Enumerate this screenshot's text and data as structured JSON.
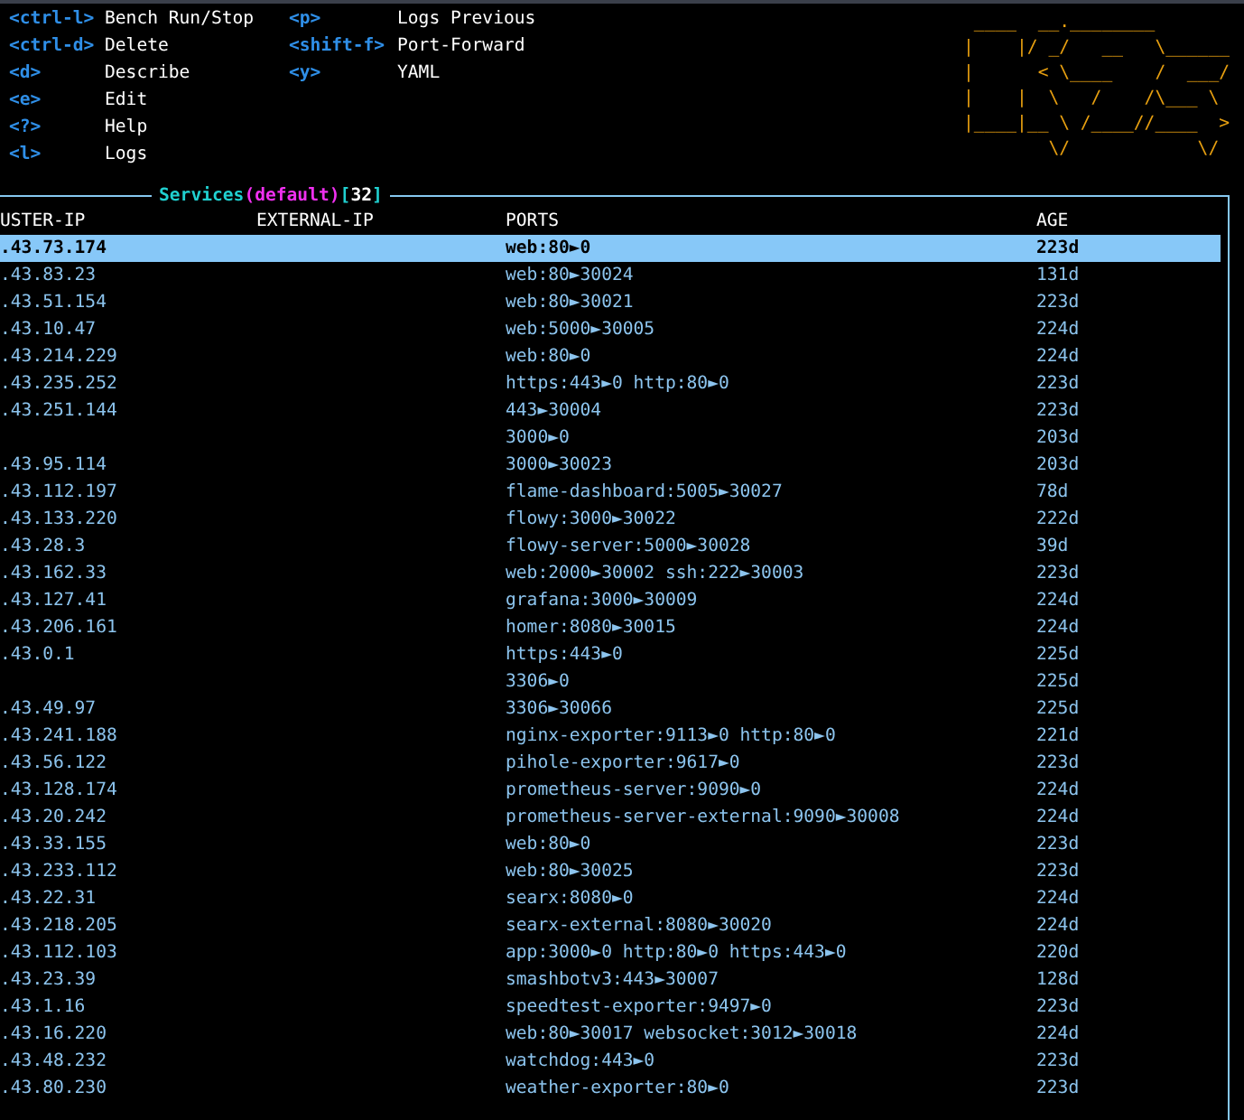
{
  "hints": [
    {
      "key": "<ctrl-l>",
      "action": "Bench Run/Stop"
    },
    {
      "key": "<ctrl-d>",
      "action": "Delete"
    },
    {
      "key": "<d>",
      "action": "Describe"
    },
    {
      "key": "<e>",
      "action": "Edit"
    },
    {
      "key": "<?>",
      "action": "Help"
    },
    {
      "key": "<l>",
      "action": "Logs"
    },
    {
      "key": "<p>",
      "action": "Logs Previous"
    },
    {
      "key": "<shift-f>",
      "action": "Port-Forward"
    },
    {
      "key": "<y>",
      "action": "YAML"
    }
  ],
  "logo": {
    "lines": [
      " ____  __.________       ",
      "|    |/ _/   __   \\______",
      "|      < \\____    /  ___/",
      "|    |  \\   /    /\\___ \\ ",
      "|____|__ \\ /____//____  >",
      "        \\/            \\/ "
    ]
  },
  "table": {
    "title": [
      {
        "kind": "resource",
        "text": "Services"
      },
      {
        "kind": "namespace",
        "text": "(default)"
      },
      {
        "kind": "bracket",
        "text": "["
      },
      {
        "kind": "count",
        "text": "32"
      },
      {
        "kind": "bracket",
        "text": "]"
      }
    ],
    "columns": [
      "USTER-IP",
      "EXTERNAL-IP",
      "PORTS",
      "AGE"
    ],
    "rows": [
      {
        "cluster_ip": ".43.73.174",
        "ports": "web:80►0",
        "age": "223d",
        "selected": true
      },
      {
        "cluster_ip": ".43.83.23",
        "ports": "web:80►30024",
        "age": "131d",
        "selected": false
      },
      {
        "cluster_ip": ".43.51.154",
        "ports": "web:80►30021",
        "age": "223d",
        "selected": false
      },
      {
        "cluster_ip": ".43.10.47",
        "ports": "web:5000►30005",
        "age": "224d",
        "selected": false
      },
      {
        "cluster_ip": ".43.214.229",
        "ports": "web:80►0",
        "age": "224d",
        "selected": false
      },
      {
        "cluster_ip": ".43.235.252",
        "ports": "https:443►0 http:80►0",
        "age": "223d",
        "selected": false
      },
      {
        "cluster_ip": ".43.251.144",
        "ports": "443►30004",
        "age": "223d",
        "selected": false
      },
      {
        "ports": "3000►0",
        "age": "203d",
        "selected": false
      },
      {
        "cluster_ip": ".43.95.114",
        "ports": "3000►30023",
        "age": "203d",
        "selected": false
      },
      {
        "cluster_ip": ".43.112.197",
        "ports": "flame-dashboard:5005►30027",
        "age": "78d",
        "selected": false
      },
      {
        "cluster_ip": ".43.133.220",
        "ports": "flowy:3000►30022",
        "age": "222d",
        "selected": false
      },
      {
        "cluster_ip": ".43.28.3",
        "ports": "flowy-server:5000►30028",
        "age": "39d",
        "selected": false
      },
      {
        "cluster_ip": ".43.162.33",
        "ports": "web:2000►30002 ssh:222►30003",
        "age": "223d",
        "selected": false
      },
      {
        "cluster_ip": ".43.127.41",
        "ports": "grafana:3000►30009",
        "age": "224d",
        "selected": false
      },
      {
        "cluster_ip": ".43.206.161",
        "ports": "homer:8080►30015",
        "age": "224d",
        "selected": false
      },
      {
        "cluster_ip": ".43.0.1",
        "ports": "https:443►0",
        "age": "225d",
        "selected": false
      },
      {
        "ports": "3306►0",
        "age": "225d",
        "selected": false
      },
      {
        "cluster_ip": ".43.49.97",
        "ports": "3306►30066",
        "age": "225d",
        "selected": false
      },
      {
        "cluster_ip": ".43.241.188",
        "ports": "nginx-exporter:9113►0 http:80►0",
        "age": "221d",
        "selected": false
      },
      {
        "cluster_ip": ".43.56.122",
        "ports": "pihole-exporter:9617►0",
        "age": "223d",
        "selected": false
      },
      {
        "cluster_ip": ".43.128.174",
        "ports": "prometheus-server:9090►0",
        "age": "224d",
        "selected": false
      },
      {
        "cluster_ip": ".43.20.242",
        "ports": "prometheus-server-external:9090►30008",
        "age": "224d",
        "selected": false
      },
      {
        "cluster_ip": ".43.33.155",
        "ports": "web:80►0",
        "age": "223d",
        "selected": false
      },
      {
        "cluster_ip": ".43.233.112",
        "ports": "web:80►30025",
        "age": "223d",
        "selected": false
      },
      {
        "cluster_ip": ".43.22.31",
        "ports": "searx:8080►0",
        "age": "224d",
        "selected": false
      },
      {
        "cluster_ip": ".43.218.205",
        "ports": "searx-external:8080►30020",
        "age": "224d",
        "selected": false
      },
      {
        "cluster_ip": ".43.112.103",
        "ports": "app:3000►0 http:80►0 https:443►0",
        "age": "220d",
        "selected": false
      },
      {
        "cluster_ip": ".43.23.39",
        "ports": "smashbotv3:443►30007",
        "age": "128d",
        "selected": false
      },
      {
        "cluster_ip": ".43.1.16",
        "ports": "speedtest-exporter:9497►0",
        "age": "223d",
        "selected": false
      },
      {
        "cluster_ip": ".43.16.220",
        "ports": "web:80►30017 websocket:3012►30018",
        "age": "224d",
        "selected": false
      },
      {
        "cluster_ip": ".43.48.232",
        "ports": "watchdog:443►0",
        "age": "223d",
        "selected": false
      },
      {
        "cluster_ip": ".43.80.230",
        "ports": "weather-exporter:80►0",
        "age": "223d",
        "selected": false
      }
    ]
  }
}
